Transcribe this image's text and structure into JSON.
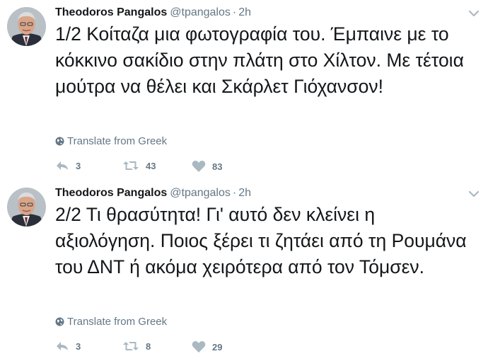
{
  "tweets": [
    {
      "author_name": "Theodoros Pangalos",
      "handle": "@tpangalos",
      "separator": "·",
      "time": "2h",
      "text": "1/2 Κοίταζα μια φωτογραφία του. Έμπαινε με το κόκκινο σακίδιο στην πλάτη στο Χίλτον. Με τέτοια μούτρα να θέλει και Σκάρλετ Γιόχανσον!",
      "translate": "Translate from Greek",
      "replies": "3",
      "retweets": "43",
      "likes": "83"
    },
    {
      "author_name": "Theodoros Pangalos",
      "handle": "@tpangalos",
      "separator": "·",
      "time": "2h",
      "text": "2/2 Τι θρασύτητα! Γι' αυτό δεν κλείνει η αξιολόγηση. Ποιος ξέρει τι ζητάει από τη Ρουμάνα του ΔΝΤ ή ακόμα χειρότερα από τον Τόμσεν.",
      "translate": "Translate from Greek",
      "replies": "3",
      "retweets": "8",
      "likes": "29"
    }
  ],
  "icons": {
    "reply": "reply-icon",
    "retweet": "retweet-icon",
    "like": "heart-icon",
    "globe": "globe-icon",
    "caret": "chevron-down-icon"
  },
  "colors": {
    "text": "#14171a",
    "secondary": "#657786",
    "icon": "#aab8c2"
  }
}
